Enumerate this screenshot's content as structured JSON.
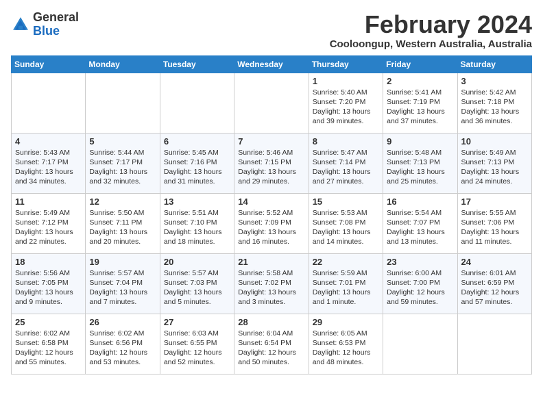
{
  "header": {
    "logo_general": "General",
    "logo_blue": "Blue",
    "title": "February 2024",
    "subtitle": "Cooloongup, Western Australia, Australia"
  },
  "days_of_week": [
    "Sunday",
    "Monday",
    "Tuesday",
    "Wednesday",
    "Thursday",
    "Friday",
    "Saturday"
  ],
  "weeks": [
    [
      {
        "day": "",
        "sunrise": "",
        "sunset": "",
        "daylight": ""
      },
      {
        "day": "",
        "sunrise": "",
        "sunset": "",
        "daylight": ""
      },
      {
        "day": "",
        "sunrise": "",
        "sunset": "",
        "daylight": ""
      },
      {
        "day": "",
        "sunrise": "",
        "sunset": "",
        "daylight": ""
      },
      {
        "day": "1",
        "sunrise": "Sunrise: 5:40 AM",
        "sunset": "Sunset: 7:20 PM",
        "daylight": "Daylight: 13 hours and 39 minutes."
      },
      {
        "day": "2",
        "sunrise": "Sunrise: 5:41 AM",
        "sunset": "Sunset: 7:19 PM",
        "daylight": "Daylight: 13 hours and 37 minutes."
      },
      {
        "day": "3",
        "sunrise": "Sunrise: 5:42 AM",
        "sunset": "Sunset: 7:18 PM",
        "daylight": "Daylight: 13 hours and 36 minutes."
      }
    ],
    [
      {
        "day": "4",
        "sunrise": "Sunrise: 5:43 AM",
        "sunset": "Sunset: 7:17 PM",
        "daylight": "Daylight: 13 hours and 34 minutes."
      },
      {
        "day": "5",
        "sunrise": "Sunrise: 5:44 AM",
        "sunset": "Sunset: 7:17 PM",
        "daylight": "Daylight: 13 hours and 32 minutes."
      },
      {
        "day": "6",
        "sunrise": "Sunrise: 5:45 AM",
        "sunset": "Sunset: 7:16 PM",
        "daylight": "Daylight: 13 hours and 31 minutes."
      },
      {
        "day": "7",
        "sunrise": "Sunrise: 5:46 AM",
        "sunset": "Sunset: 7:15 PM",
        "daylight": "Daylight: 13 hours and 29 minutes."
      },
      {
        "day": "8",
        "sunrise": "Sunrise: 5:47 AM",
        "sunset": "Sunset: 7:14 PM",
        "daylight": "Daylight: 13 hours and 27 minutes."
      },
      {
        "day": "9",
        "sunrise": "Sunrise: 5:48 AM",
        "sunset": "Sunset: 7:13 PM",
        "daylight": "Daylight: 13 hours and 25 minutes."
      },
      {
        "day": "10",
        "sunrise": "Sunrise: 5:49 AM",
        "sunset": "Sunset: 7:13 PM",
        "daylight": "Daylight: 13 hours and 24 minutes."
      }
    ],
    [
      {
        "day": "11",
        "sunrise": "Sunrise: 5:49 AM",
        "sunset": "Sunset: 7:12 PM",
        "daylight": "Daylight: 13 hours and 22 minutes."
      },
      {
        "day": "12",
        "sunrise": "Sunrise: 5:50 AM",
        "sunset": "Sunset: 7:11 PM",
        "daylight": "Daylight: 13 hours and 20 minutes."
      },
      {
        "day": "13",
        "sunrise": "Sunrise: 5:51 AM",
        "sunset": "Sunset: 7:10 PM",
        "daylight": "Daylight: 13 hours and 18 minutes."
      },
      {
        "day": "14",
        "sunrise": "Sunrise: 5:52 AM",
        "sunset": "Sunset: 7:09 PM",
        "daylight": "Daylight: 13 hours and 16 minutes."
      },
      {
        "day": "15",
        "sunrise": "Sunrise: 5:53 AM",
        "sunset": "Sunset: 7:08 PM",
        "daylight": "Daylight: 13 hours and 14 minutes."
      },
      {
        "day": "16",
        "sunrise": "Sunrise: 5:54 AM",
        "sunset": "Sunset: 7:07 PM",
        "daylight": "Daylight: 13 hours and 13 minutes."
      },
      {
        "day": "17",
        "sunrise": "Sunrise: 5:55 AM",
        "sunset": "Sunset: 7:06 PM",
        "daylight": "Daylight: 13 hours and 11 minutes."
      }
    ],
    [
      {
        "day": "18",
        "sunrise": "Sunrise: 5:56 AM",
        "sunset": "Sunset: 7:05 PM",
        "daylight": "Daylight: 13 hours and 9 minutes."
      },
      {
        "day": "19",
        "sunrise": "Sunrise: 5:57 AM",
        "sunset": "Sunset: 7:04 PM",
        "daylight": "Daylight: 13 hours and 7 minutes."
      },
      {
        "day": "20",
        "sunrise": "Sunrise: 5:57 AM",
        "sunset": "Sunset: 7:03 PM",
        "daylight": "Daylight: 13 hours and 5 minutes."
      },
      {
        "day": "21",
        "sunrise": "Sunrise: 5:58 AM",
        "sunset": "Sunset: 7:02 PM",
        "daylight": "Daylight: 13 hours and 3 minutes."
      },
      {
        "day": "22",
        "sunrise": "Sunrise: 5:59 AM",
        "sunset": "Sunset: 7:01 PM",
        "daylight": "Daylight: 13 hours and 1 minute."
      },
      {
        "day": "23",
        "sunrise": "Sunrise: 6:00 AM",
        "sunset": "Sunset: 7:00 PM",
        "daylight": "Daylight: 12 hours and 59 minutes."
      },
      {
        "day": "24",
        "sunrise": "Sunrise: 6:01 AM",
        "sunset": "Sunset: 6:59 PM",
        "daylight": "Daylight: 12 hours and 57 minutes."
      }
    ],
    [
      {
        "day": "25",
        "sunrise": "Sunrise: 6:02 AM",
        "sunset": "Sunset: 6:58 PM",
        "daylight": "Daylight: 12 hours and 55 minutes."
      },
      {
        "day": "26",
        "sunrise": "Sunrise: 6:02 AM",
        "sunset": "Sunset: 6:56 PM",
        "daylight": "Daylight: 12 hours and 53 minutes."
      },
      {
        "day": "27",
        "sunrise": "Sunrise: 6:03 AM",
        "sunset": "Sunset: 6:55 PM",
        "daylight": "Daylight: 12 hours and 52 minutes."
      },
      {
        "day": "28",
        "sunrise": "Sunrise: 6:04 AM",
        "sunset": "Sunset: 6:54 PM",
        "daylight": "Daylight: 12 hours and 50 minutes."
      },
      {
        "day": "29",
        "sunrise": "Sunrise: 6:05 AM",
        "sunset": "Sunset: 6:53 PM",
        "daylight": "Daylight: 12 hours and 48 minutes."
      },
      {
        "day": "",
        "sunrise": "",
        "sunset": "",
        "daylight": ""
      },
      {
        "day": "",
        "sunrise": "",
        "sunset": "",
        "daylight": ""
      }
    ]
  ]
}
